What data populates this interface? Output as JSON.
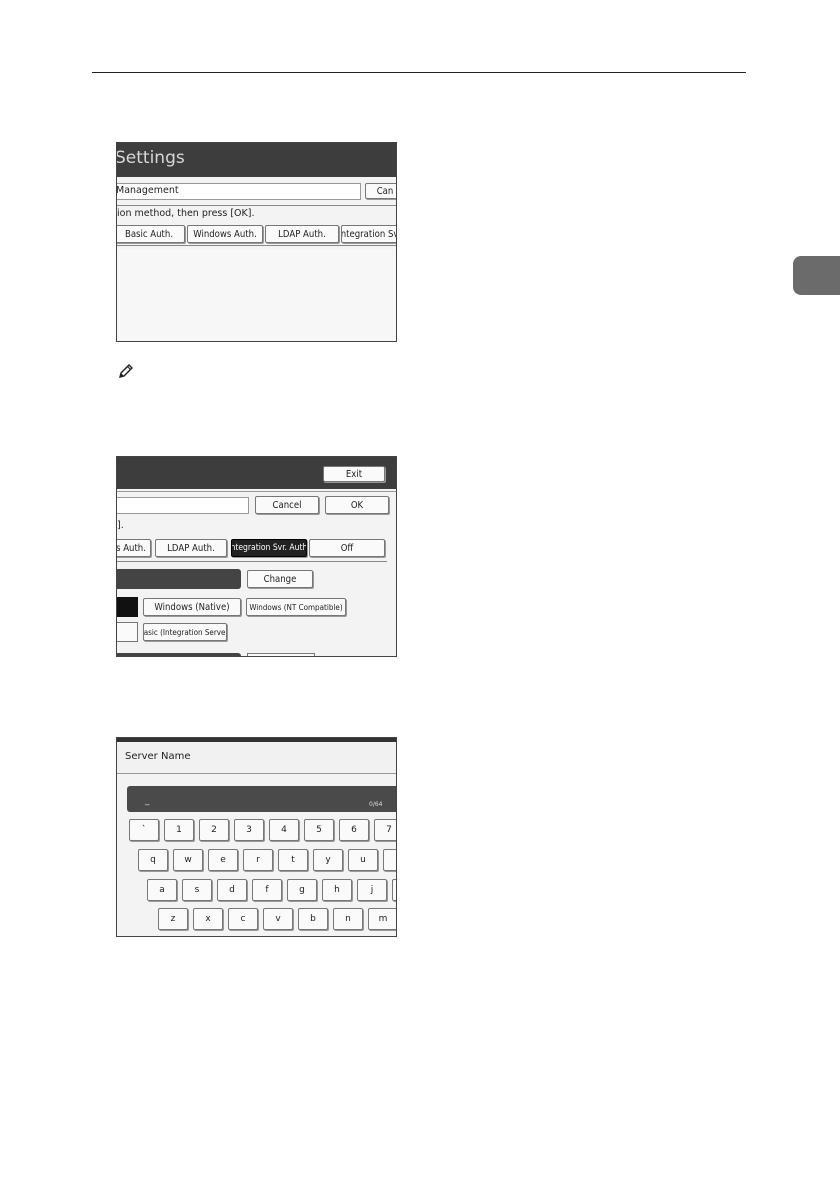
{
  "shot1": {
    "title": "Settings",
    "field_label": "Management",
    "cancel_button": "Can",
    "instruction": "ion method, then press [OK].",
    "auth_buttons": [
      "Basic Auth.",
      "Windows Auth.",
      "LDAP Auth.",
      "Integration Svr."
    ]
  },
  "shot2": {
    "exit_button": "Exit",
    "cancel_button": "Cancel",
    "ok_button": "OK",
    "instruction": "].",
    "auth_buttons": [
      "s Auth.",
      "LDAP Auth.",
      "Integration Svr. Auth.",
      "Off"
    ],
    "change_button": "Change",
    "type_buttons": [
      "Windows (Native)",
      "Windows (NT Compatible)"
    ],
    "basic_button": "Basic (Integration Server)"
  },
  "shot3": {
    "header_title": "Server Name",
    "cursor": "_",
    "counter": "0/64",
    "row1": [
      "`",
      "1",
      "2",
      "3",
      "4",
      "5",
      "6",
      "7"
    ],
    "row2": [
      "q",
      "w",
      "e",
      "r",
      "t",
      "y",
      "u",
      ""
    ],
    "row3": [
      "a",
      "s",
      "d",
      "f",
      "g",
      "h",
      "j",
      ""
    ],
    "row4": [
      "z",
      "x",
      "c",
      "v",
      "b",
      "n",
      "m"
    ]
  }
}
